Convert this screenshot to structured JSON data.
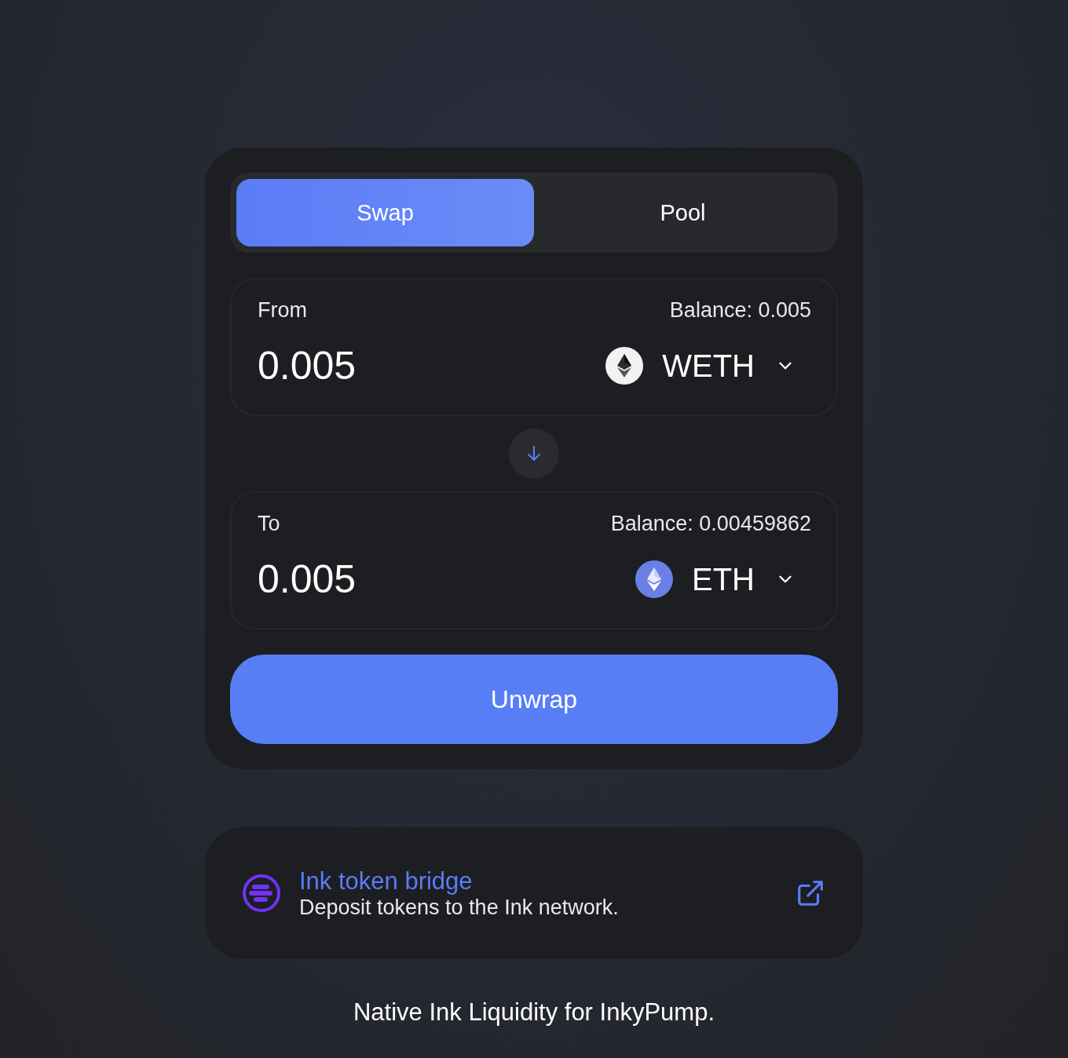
{
  "tabs": [
    {
      "label": "Swap",
      "selected": true
    },
    {
      "label": "Pool",
      "selected": false
    }
  ],
  "panels": [
    {
      "label": "From",
      "balance": "Balance: 0.005",
      "amount": "0.005",
      "token": {
        "symbol": "WETH",
        "kind": "weth"
      }
    },
    {
      "label": "To",
      "balance": "Balance: 0.00459862",
      "amount": "0.005",
      "token": {
        "symbol": "ETH",
        "kind": "eth"
      }
    }
  ],
  "action_button": "Unwrap",
  "bridge": {
    "title": "Ink token bridge",
    "description": "Deposit tokens to the Ink network."
  },
  "footer": "Native Ink Liquidity for InkyPump."
}
